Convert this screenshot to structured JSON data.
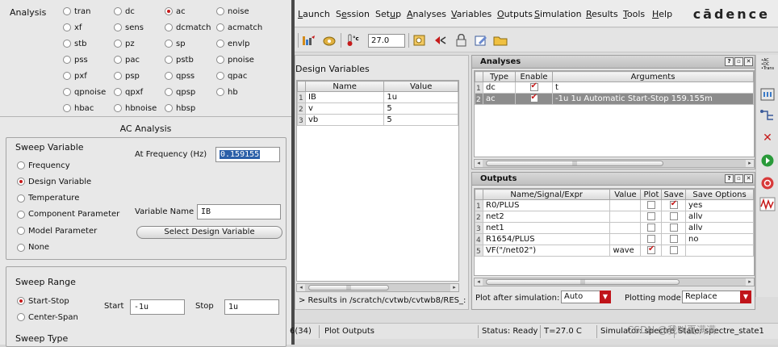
{
  "analysis_form": {
    "analysis_label": "Analysis",
    "analysis_types": [
      [
        "tran",
        "dc",
        "ac",
        "noise"
      ],
      [
        "xf",
        "sens",
        "dcmatch",
        "acmatch"
      ],
      [
        "stb",
        "pz",
        "sp",
        "envlp"
      ],
      [
        "pss",
        "pac",
        "pstb",
        "pnoise"
      ],
      [
        "pxf",
        "psp",
        "qpss",
        "qpac"
      ],
      [
        "qpnoise",
        "qpxf",
        "qpsp",
        "hb"
      ],
      [
        "hbac",
        "hbnoise",
        "hbsp"
      ]
    ],
    "selected_analysis": "ac",
    "section_title": "AC Analysis",
    "sweep_variable": {
      "heading": "Sweep Variable",
      "options": [
        "Frequency",
        "Design Variable",
        "Temperature",
        "Component Parameter",
        "Model Parameter",
        "None"
      ],
      "selected": "Design Variable",
      "at_frequency_label": "At Frequency (Hz)",
      "at_frequency_value": "0.159155",
      "variable_name_label": "Variable Name",
      "variable_name_value": "IB",
      "select_button": "Select Design Variable"
    },
    "sweep_range": {
      "heading": "Sweep Range",
      "options": [
        "Start-Stop",
        "Center-Span"
      ],
      "selected": "Start-Stop",
      "start_label": "Start",
      "start_value": "-1u",
      "stop_label": "Stop",
      "stop_value": "1u"
    },
    "sweep_type_label": "Sweep Type"
  },
  "menubar": {
    "items": [
      {
        "pre": "",
        "mn": "L",
        "post": "aunch"
      },
      {
        "pre": "S",
        "mn": "e",
        "post": "ssion"
      },
      {
        "pre": "Set",
        "mn": "u",
        "post": "p"
      },
      {
        "pre": "",
        "mn": "A",
        "post": "nalyses"
      },
      {
        "pre": "",
        "mn": "V",
        "post": "ariables"
      },
      {
        "pre": "",
        "mn": "O",
        "post": "utputs"
      },
      {
        "pre": "",
        "mn": "S",
        "post": "imulation"
      },
      {
        "pre": "",
        "mn": "R",
        "post": "esults"
      },
      {
        "pre": "",
        "mn": "T",
        "post": "ools"
      },
      {
        "pre": "",
        "mn": "H",
        "post": "elp"
      }
    ],
    "brand": "cādence"
  },
  "toolbar": {
    "temperature_value": "27.0"
  },
  "design_variables": {
    "title": "Design Variables",
    "columns": [
      "Name",
      "Value"
    ],
    "rows": [
      {
        "idx": "1",
        "name": "IB",
        "value": "1u"
      },
      {
        "idx": "2",
        "name": "v",
        "value": "5"
      },
      {
        "idx": "3",
        "name": "vb",
        "value": "5"
      }
    ],
    "results_path": "> Results in /scratch/cvtwb/cvtwb8/RES_:"
  },
  "analyses": {
    "title": "Analyses",
    "columns": [
      "Type",
      "Enable",
      "Arguments"
    ],
    "rows": [
      {
        "idx": "1",
        "type": "dc",
        "enabled": true,
        "args": "t"
      },
      {
        "idx": "2",
        "type": "ac",
        "enabled": true,
        "args": "-1u 1u Automatic Start-Stop 159.155m"
      }
    ],
    "win_buttons": [
      "?",
      "▫",
      "✕"
    ]
  },
  "outputs": {
    "title": "Outputs",
    "columns": [
      "Name/Signal/Expr",
      "Value",
      "Plot",
      "Save",
      "Save Options"
    ],
    "rows": [
      {
        "idx": "1",
        "name": "R0/PLUS",
        "value": "",
        "plot": false,
        "save": true,
        "opts": "yes"
      },
      {
        "idx": "2",
        "name": "net2",
        "value": "",
        "plot": false,
        "save": false,
        "opts": "allv"
      },
      {
        "idx": "3",
        "name": "net1",
        "value": "",
        "plot": false,
        "save": false,
        "opts": "allv"
      },
      {
        "idx": "4",
        "name": "R1654/PLUS",
        "value": "",
        "plot": false,
        "save": false,
        "opts": "no"
      },
      {
        "idx": "5",
        "name": "VF(\"/net02\")",
        "value": "wave",
        "plot": true,
        "save": false,
        "opts": ""
      }
    ],
    "plot_after_label": "Plot after simulation:",
    "plot_after_value": "Auto",
    "plotting_mode_label": "Plotting mode:",
    "plotting_mode_value": "Replace"
  },
  "statusbar": {
    "counter": "6(34)",
    "plot_outputs": "Plot Outputs",
    "status": "Status: Ready",
    "temp": "T=27.0  C",
    "simulator": "Simulator: spectre",
    "state": "State: spectre_state1"
  },
  "watermark": "CSDN @我叫夏满满",
  "colors": {
    "accent_red": "#c61a1a",
    "selection_blue": "#2b5fa8",
    "row_highlight": "#8c8c8c"
  }
}
